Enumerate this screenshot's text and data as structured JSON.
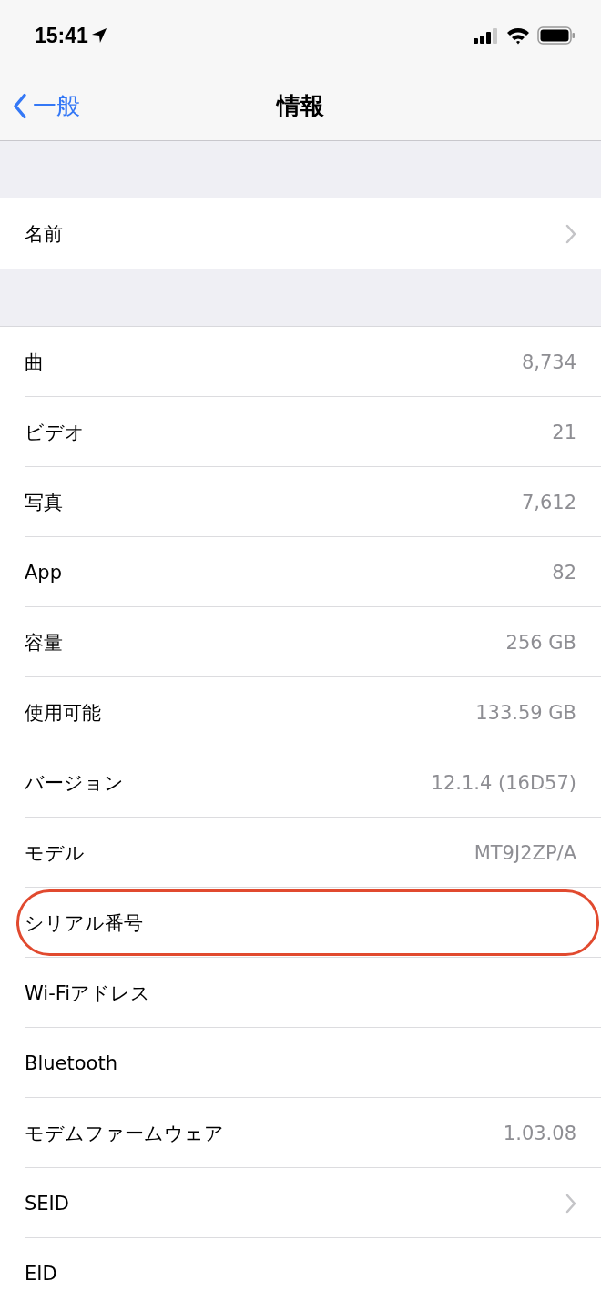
{
  "status_bar": {
    "time": "15:41"
  },
  "nav": {
    "back_label": "一般",
    "title": "情報"
  },
  "sections": [
    {
      "rows": [
        {
          "label": "名前",
          "kind": "chevron",
          "circled": false
        }
      ]
    },
    {
      "rows": [
        {
          "label": "曲",
          "kind": "value",
          "value": "8,734",
          "circled": false
        },
        {
          "label": "ビデオ",
          "kind": "value",
          "value": "21",
          "circled": false
        },
        {
          "label": "写真",
          "kind": "value",
          "value": "7,612",
          "circled": false
        },
        {
          "label": "App",
          "kind": "value",
          "value": "82",
          "circled": false
        },
        {
          "label": "容量",
          "kind": "value",
          "value": "256 GB",
          "circled": false
        },
        {
          "label": "使用可能",
          "kind": "value",
          "value": "133.59 GB",
          "circled": false
        },
        {
          "label": "バージョン",
          "kind": "value",
          "value": "12.1.4 (16D57)",
          "circled": false
        },
        {
          "label": "モデル",
          "kind": "value",
          "value": "MT9J2ZP/A",
          "circled": false
        },
        {
          "label": "シリアル番号",
          "kind": "plain",
          "circled": true
        },
        {
          "label": "Wi-Fiアドレス",
          "kind": "plain",
          "circled": false
        },
        {
          "label": "Bluetooth",
          "kind": "plain",
          "circled": false
        },
        {
          "label": "モデムファームウェア",
          "kind": "value",
          "value": "1.03.08",
          "circled": false
        },
        {
          "label": "SEID",
          "kind": "chevron",
          "circled": false
        },
        {
          "label": "EID",
          "kind": "plain",
          "circled": false
        }
      ]
    }
  ]
}
